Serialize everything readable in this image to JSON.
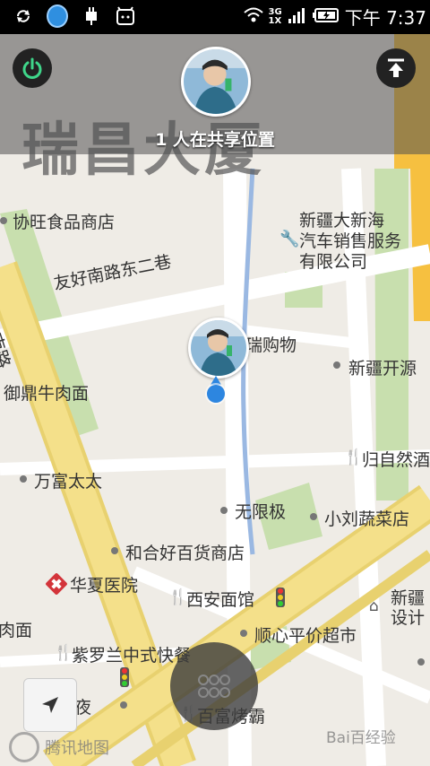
{
  "status_bar": {
    "net_top": "3G",
    "net_bottom": "1X",
    "time": "下午 7:37"
  },
  "share": {
    "text": "1 人在共享位置"
  },
  "map": {
    "roads": {
      "youhao": "友好南路东二巷",
      "hao_nan_lu": "好南路"
    },
    "pois": {
      "xiewang": "协旺食品商店",
      "xinjiang_daxinhai": "新疆大新海",
      "qiche": "汽车销售服务",
      "youxian": "有限公司",
      "ruigouwu": "瑞购物",
      "xinjiang_kaiyuan": "新疆开源",
      "yuding": "御鼎牛肉面",
      "guiziran": "归自然酒",
      "wanfu": "万富太太",
      "wuxianji": "无限极",
      "xiaoliu": "小刘蔬菜店",
      "hehehao": "和合好百货商店",
      "huaxia": "华夏医院",
      "xian": "西安面馆",
      "xinjiang_sheji_1": "新疆",
      "xinjiang_sheji_2": "设计",
      "shunxin": "顺心平价超市",
      "roumian": "肉面",
      "ziluolan": "紫罗兰中式快餐",
      "baihuaye": "白夜",
      "baifu": "百富烤霸"
    },
    "top_building": "瑞昌大厦"
  },
  "watermarks": {
    "tencent": "腾讯地图",
    "baidu": "Bai百经验"
  }
}
